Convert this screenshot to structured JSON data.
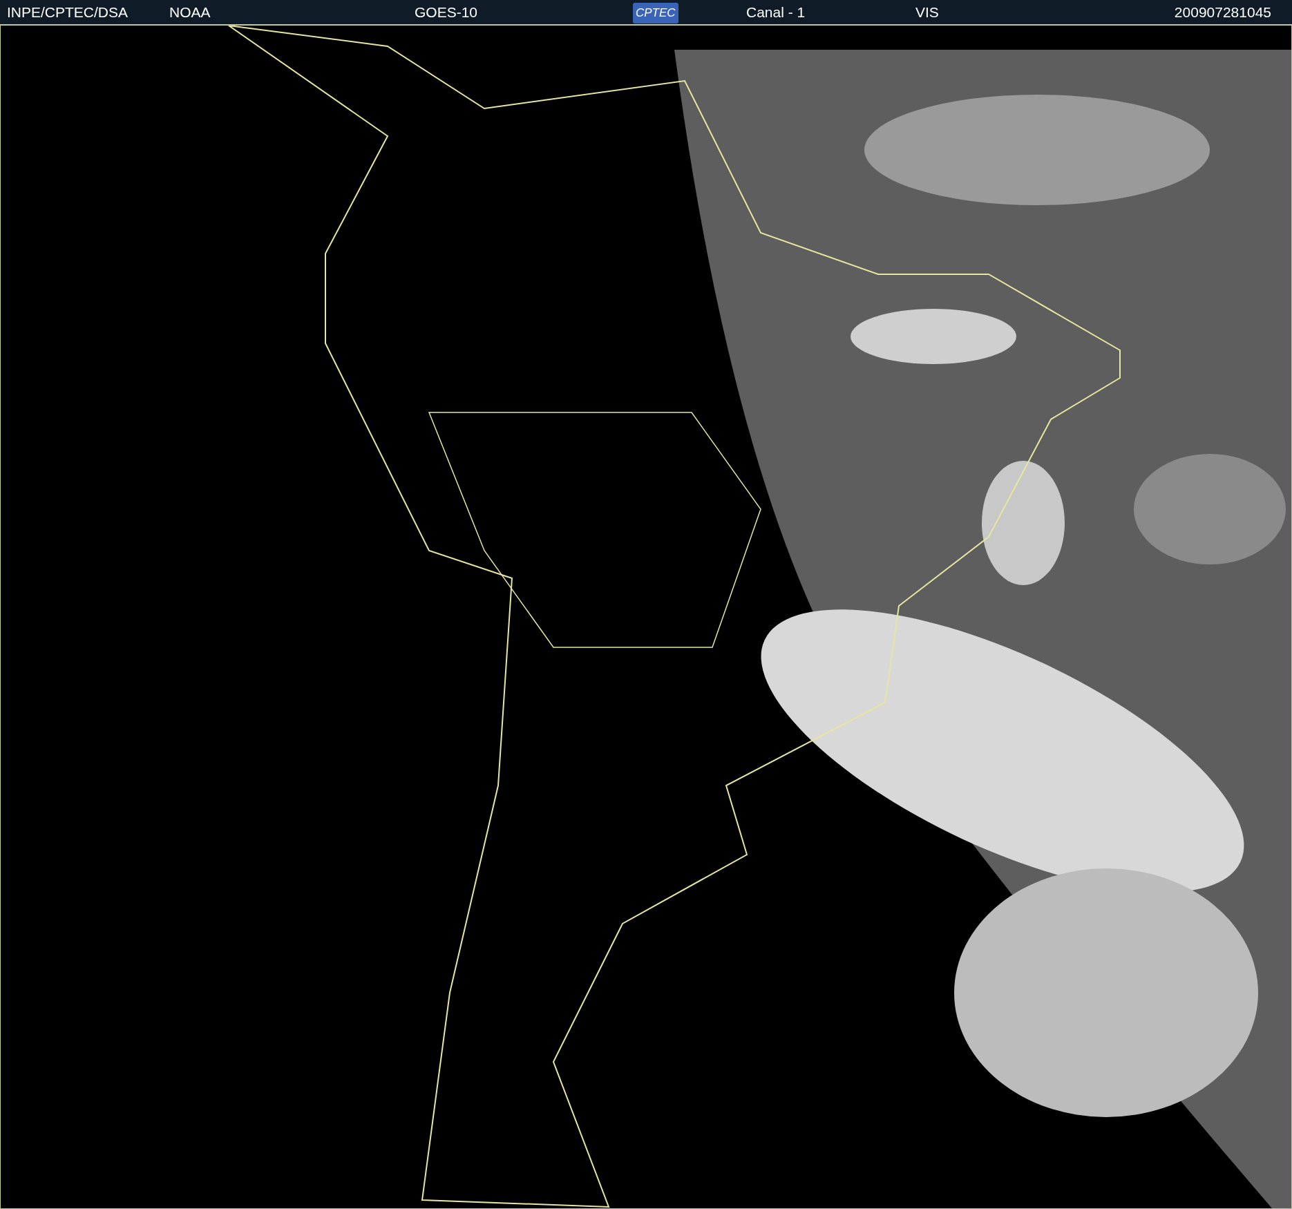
{
  "header": {
    "items": [
      {
        "kind": "text",
        "text": "INPE/CPTEC/DSA"
      },
      {
        "kind": "text",
        "text": "NOAA"
      },
      {
        "kind": "text",
        "text": "GOES-10"
      },
      {
        "kind": "logo",
        "text": "CPTEC"
      },
      {
        "kind": "text",
        "text": "Canal - 1"
      },
      {
        "kind": "text",
        "text": "VIS"
      },
      {
        "kind": "text",
        "text": "200907281045"
      }
    ]
  }
}
